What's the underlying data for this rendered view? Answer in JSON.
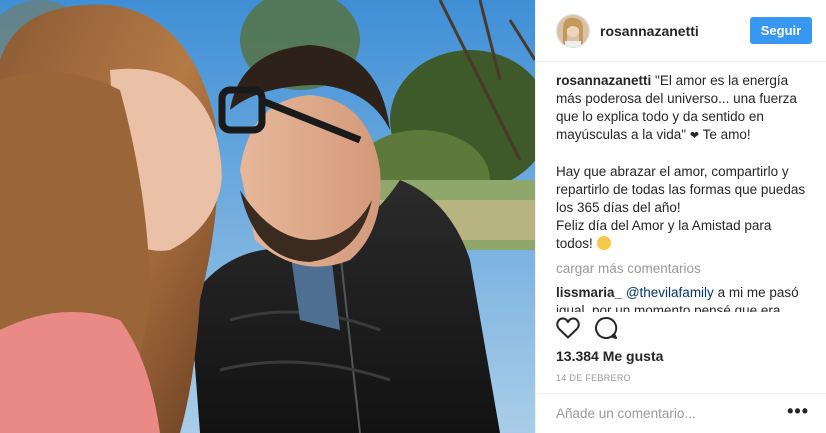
{
  "post": {
    "username": "rosannazanetti",
    "follow_label": "Seguir",
    "caption_user": "rosannazanetti",
    "caption_part1": "\"El amor es la energía más poderosa del universo... una fuerza que lo explica todo y da sentido en mayúsculas a la vida\" ",
    "caption_heart": "❤",
    "caption_part2": " Te amo!\n\nHay que abrazar el amor, compartirlo y repartirlo de todas las formas que puedas los 365 días del año!\nFeliz día del Amor y la Amistad para todos! ",
    "caption_emoji": "smiling-face-emoji",
    "load_more": "cargar más comentarios",
    "comment_user": "lissmaria_",
    "comment_mention": "@thevilafamily",
    "comment_text": " a mi me pasó igual, por un momento pensé que era Jennifer López ......se parecen muchísimo",
    "likes": "13.384 Me gusta",
    "date": "14 DE FEBRERO",
    "add_comment_placeholder": "Añade un comentario...",
    "more_options": "•••"
  },
  "icons": {
    "like": "heart-outline-icon",
    "comment": "comment-bubble-icon"
  },
  "colors": {
    "follow_button": "#3897f0",
    "mention": "#003569",
    "muted_text": "#999999"
  }
}
